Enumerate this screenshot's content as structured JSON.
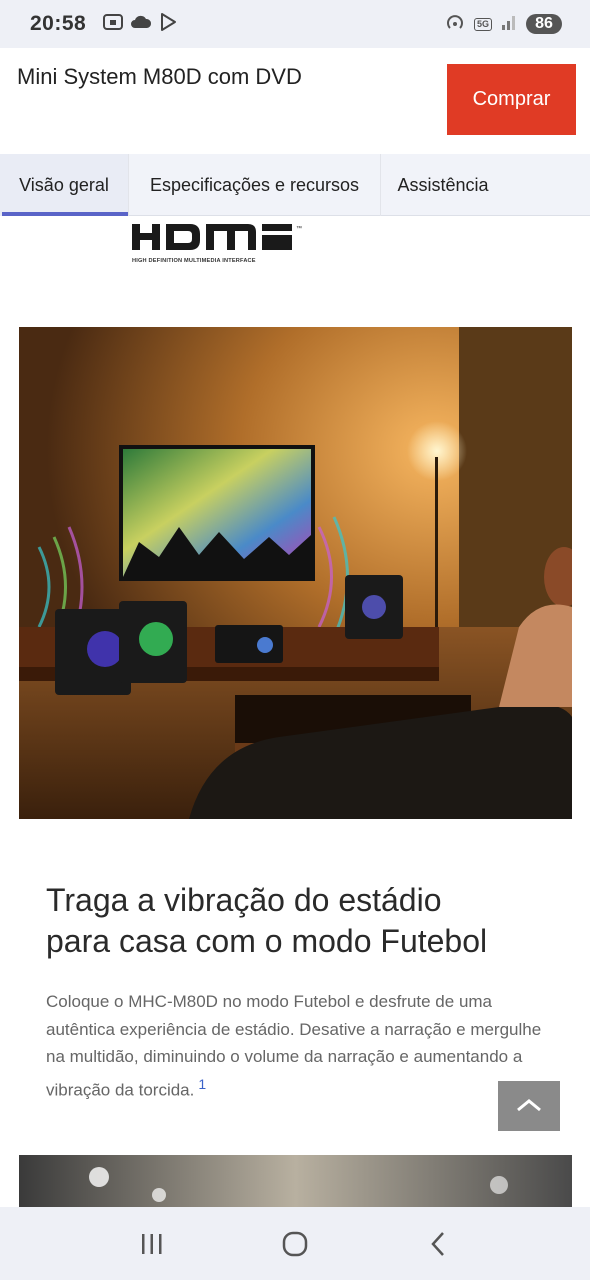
{
  "status_bar": {
    "time": "20:58",
    "battery": "86",
    "network": "5G",
    "icons_left": [
      "screen-record-icon",
      "cloud-icon",
      "play-store-icon"
    ],
    "icons_right": [
      "hotspot-icon",
      "5g-icon",
      "signal-icon",
      "battery-icon"
    ]
  },
  "header": {
    "title": "Mini System M80D com DVD",
    "buy_label": "Comprar"
  },
  "tabs": [
    {
      "label": "Visão geral",
      "active": true
    },
    {
      "label": "Especificações e recursos",
      "active": false
    },
    {
      "label": "Assistência",
      "active": false
    }
  ],
  "logo": {
    "text": "HDMI",
    "subtitle": "HIGH DEFINITION MULTIMEDIA INTERFACE",
    "tm": "™"
  },
  "section": {
    "headline_line1": "Traga a vibração do estádio",
    "headline_line2": "para casa com o modo Futebol",
    "body": "Coloque o MHC-M80D no modo Futebol e desfrute de uma autêntica experiência de estádio. Desative a narração e mergulhe na multidão, diminuindo o volume da narração e aumentando a vibração da torcida.",
    "footnote": "1"
  },
  "colors": {
    "accent_buy": "#e03b25",
    "tab_active": "#5a64c8",
    "footnote": "#3b62c8"
  },
  "nav": [
    "recent-apps-icon",
    "home-icon",
    "back-icon"
  ]
}
